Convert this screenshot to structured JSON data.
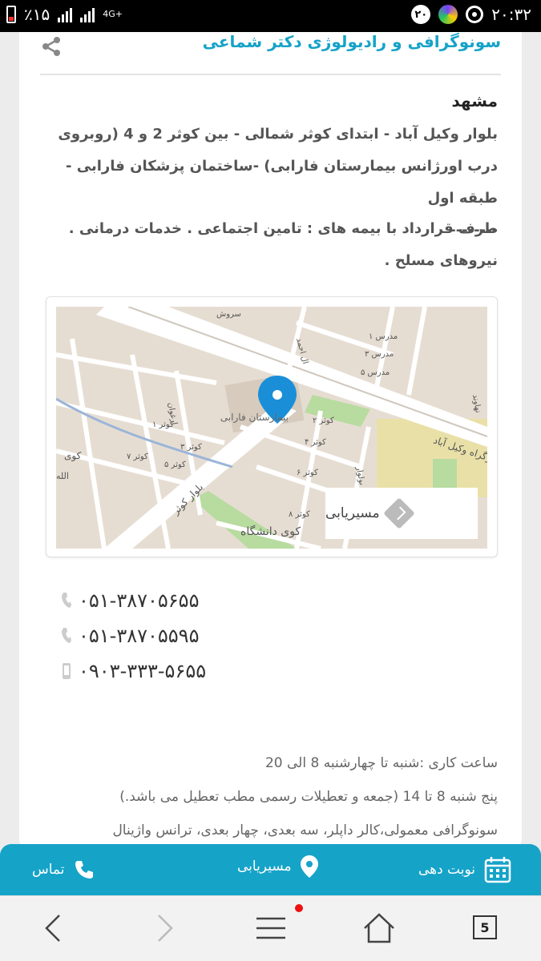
{
  "status_bar": {
    "battery_text": "٪۱۵",
    "network_text": "4G+",
    "notification_count": "۲۰",
    "time": "۲۰:۳۲"
  },
  "header": {
    "clinic_title": "سونوگرافی و رادیولوژی دکتر شماعی"
  },
  "location": {
    "city": "مشهد",
    "address": "بلوار وکیل آباد - ابتدای کوثر شمالی - بین کوثر 2 و 4 (روبروی درب اورژانس بیمارستان فارابی) -ساختمان پزشکان فارابی - طبقه اول",
    "separator": "--------",
    "contract": "طرف قرارداد با بیمه های : تامین اجتماعی . خدمات درمانی . نیروهای مسلح ."
  },
  "map": {
    "route_label": "مسیریابی",
    "labels": {
      "hospital": "بیمارستان فارابی",
      "university": "کوی دانشگاه",
      "kowsar_blvd": "بلوار کوثر",
      "vakil_abad": "بزرگراه وکیل آباد",
      "kowsar_2": "کوثر ۲",
      "kowsar_4": "کوثر ۴",
      "kowsar_6": "کوثر ۶",
      "kowsar_8": "کوثر ۸",
      "kowsar_5": "کوثر ۵",
      "kowsar_3": "کوثر ۳",
      "kowsar_1": "کوثر ۱",
      "kowsar_7": "کوثر ۷",
      "modares_1": "مدرس ۱",
      "modares_3": "مدرس ۳",
      "modares_5": "مدرس ۵",
      "arghavan": "ارغوان",
      "koy": "کوی",
      "allah": "الله",
      "ahmad": "ال احمد",
      "sarv": "سروش",
      "naharan": "نهاوند",
      "boulevard": "بولوار"
    },
    "colors": {
      "land": "#e6ddd2",
      "road": "#ffffff",
      "park": "#b8dba0",
      "campus": "#e9e0a8",
      "pin": "#1a8fd8"
    }
  },
  "contacts": [
    {
      "number": "۰۵۱-۳۸۷۰۵۶۵۵",
      "type": "phone"
    },
    {
      "number": "۰۵۱-۳۸۷۰۵۵۹۵",
      "type": "phone"
    },
    {
      "number": "۰۹۰۳-۳۳۳-۵۶۵۵",
      "type": "mobile"
    }
  ],
  "hours": {
    "line1": "ساعت کاری :شنبه تا چهارشنبه 8 الی 20",
    "line2": "پنج شنبه 8 تا 14 (جمعه و تعطیلات رسمی مطب تعطیل می باشد.)",
    "line3": "سونوگرافی معمولی،کالر داپلر، سه بعدی، چهار بعدی، ترانس واژینال"
  },
  "app_nav": {
    "appointment_label": "نوبت دهی",
    "route_label": "مسیریابی",
    "call_label": "تماس",
    "accent_color": "#16a3c8"
  },
  "browser": {
    "tab_count": "5"
  }
}
